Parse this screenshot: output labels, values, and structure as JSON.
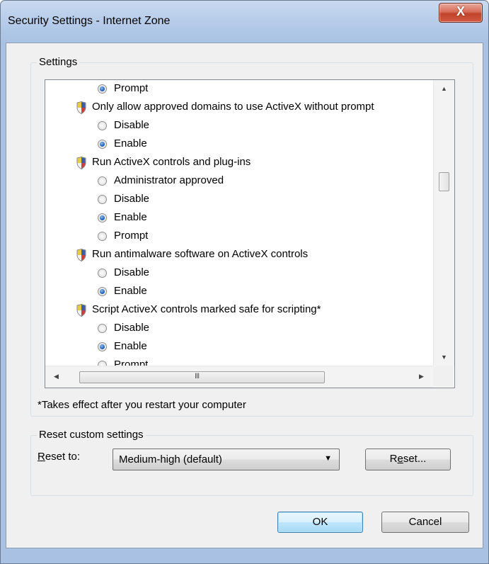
{
  "window": {
    "title": "Security Settings - Internet Zone",
    "close_glyph": "X"
  },
  "settings_group": {
    "legend": "Settings"
  },
  "list_items": [
    {
      "type": "radio",
      "label": "Prompt",
      "checked": true
    },
    {
      "type": "header",
      "label": "Only allow approved domains to use ActiveX without prompt",
      "icon": "shield-icon"
    },
    {
      "type": "radio",
      "label": "Disable",
      "checked": false
    },
    {
      "type": "radio",
      "label": "Enable",
      "checked": true
    },
    {
      "type": "header",
      "label": "Run ActiveX controls and plug-ins",
      "icon": "shield-icon"
    },
    {
      "type": "radio",
      "label": "Administrator approved",
      "checked": false
    },
    {
      "type": "radio",
      "label": "Disable",
      "checked": false
    },
    {
      "type": "radio",
      "label": "Enable",
      "checked": true
    },
    {
      "type": "radio",
      "label": "Prompt",
      "checked": false
    },
    {
      "type": "header",
      "label": "Run antimalware software on ActiveX controls",
      "icon": "shield-icon"
    },
    {
      "type": "radio",
      "label": "Disable",
      "checked": false
    },
    {
      "type": "radio",
      "label": "Enable",
      "checked": true
    },
    {
      "type": "header",
      "label": "Script ActiveX controls marked safe for scripting*",
      "icon": "shield-icon"
    },
    {
      "type": "radio",
      "label": "Disable",
      "checked": false
    },
    {
      "type": "radio",
      "label": "Enable",
      "checked": true
    },
    {
      "type": "radio",
      "label": "Prompt",
      "checked": false
    }
  ],
  "scrollbar": {
    "up": "▲",
    "down": "▼",
    "left": "◀",
    "right": "▶",
    "grip": "III"
  },
  "footnote": "*Takes effect after you restart your computer",
  "reset_group": {
    "legend": "Reset custom settings",
    "reset_to_label_mnemonic": "R",
    "reset_to_label_rest": "eset to:",
    "combo_value": "Medium-high (default)",
    "combo_arrow": "▼",
    "reset_button_pre": "R",
    "reset_button_mnemonic": "e",
    "reset_button_post": "set..."
  },
  "buttons": {
    "ok": "OK",
    "cancel": "Cancel"
  }
}
